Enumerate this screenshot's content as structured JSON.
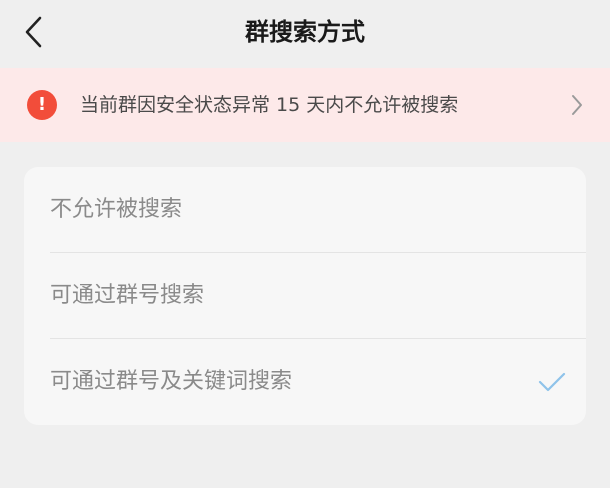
{
  "header": {
    "title": "群搜索方式",
    "back_icon": "chevron-left-icon"
  },
  "banner": {
    "icon": "exclamation-icon",
    "icon_mark": "!",
    "text": "当前群因安全状态异常 15 天内不允许被搜索",
    "chevron_icon": "chevron-right-icon",
    "accent_color": "#f24d3a",
    "background_color": "#fde9e9"
  },
  "options": {
    "items": [
      {
        "label": "不允许被搜索",
        "selected": false
      },
      {
        "label": "可通过群号搜索",
        "selected": false
      },
      {
        "label": "可通过群号及关键词搜索",
        "selected": true
      }
    ],
    "check_icon": "checkmark-icon",
    "check_color": "#8fc3ea"
  }
}
